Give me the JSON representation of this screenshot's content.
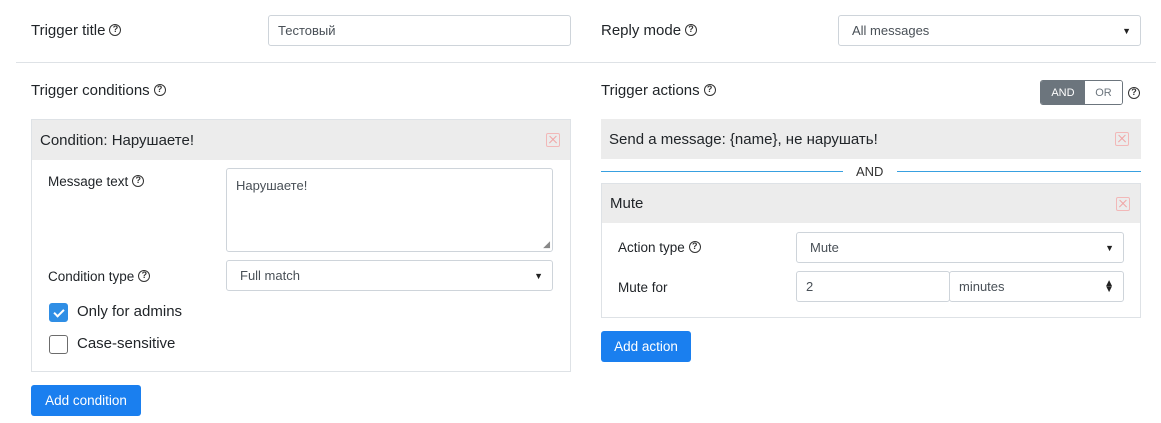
{
  "trigger_title": {
    "label": "Trigger title",
    "value": "Тестовый"
  },
  "reply_mode": {
    "label": "Reply mode",
    "value": "All messages"
  },
  "conditions": {
    "heading": "Trigger conditions",
    "card": {
      "title": "Condition: Нарушаете!",
      "message_text_label": "Message text",
      "message_text_value": "Нарушаете!",
      "condition_type_label": "Condition type",
      "condition_type_value": "Full match",
      "only_admins_label": "Only for admins",
      "only_admins_checked": true,
      "case_sensitive_label": "Case-sensitive",
      "case_sensitive_checked": false
    },
    "add_button": "Add condition"
  },
  "actions": {
    "heading": "Trigger actions",
    "toggle": {
      "and": "AND",
      "or": "OR",
      "selected": "AND"
    },
    "action1_title": "Send a message: {name}, не нарушать!",
    "separator": "AND",
    "action2": {
      "title": "Mute",
      "action_type_label": "Action type",
      "action_type_value": "Mute",
      "mute_for_label": "Mute for",
      "mute_for_value": "2",
      "mute_unit": "minutes"
    },
    "add_button": "Add action"
  },
  "icons": {
    "help": "question-circle-icon",
    "remove": "close-square-icon",
    "select": "caret-down-icon"
  },
  "colors": {
    "primary": "#1a7fef",
    "card_header": "#ececec",
    "remove_icon": "#f0a5a5",
    "separator": "#38a0e0"
  }
}
